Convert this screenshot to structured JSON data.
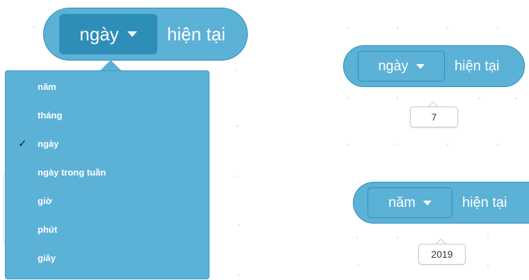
{
  "main_block": {
    "dropdown_value": "ngày",
    "label": "hiện tại",
    "menu": {
      "items": [
        {
          "label": "năm",
          "checked": false
        },
        {
          "label": "tháng",
          "checked": false
        },
        {
          "label": "ngày",
          "checked": true
        },
        {
          "label": "ngày trong tuần",
          "checked": false
        },
        {
          "label": "giờ",
          "checked": false
        },
        {
          "label": "phút",
          "checked": false
        },
        {
          "label": "giây",
          "checked": false
        }
      ],
      "check_mark": "✓"
    }
  },
  "day_block": {
    "dropdown_value": "ngày",
    "label": "hiện tại",
    "result": "7"
  },
  "year_block": {
    "dropdown_value": "năm",
    "label": "hiện tại",
    "result": "2019"
  },
  "icons": {
    "dropdown_caret": "caret-down-icon",
    "selected_check": "check-icon"
  },
  "colors": {
    "block_fill": "#5cb1d6",
    "block_border": "#2e8eb8",
    "dropdown_active": "#2e8eb8",
    "text": "#ffffff"
  }
}
